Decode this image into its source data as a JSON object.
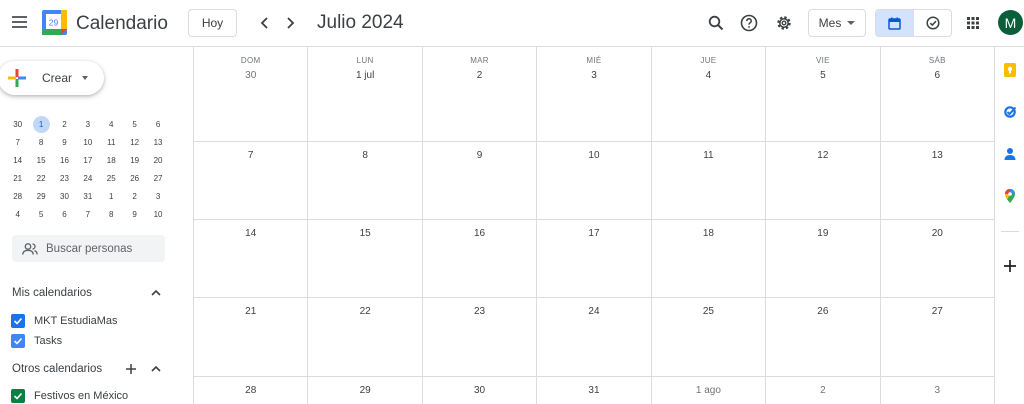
{
  "app": {
    "title": "Calendario",
    "logo_day": "29"
  },
  "toolbar": {
    "today_label": "Hoy",
    "month_title": "Julio 2024",
    "view_label": "Mes",
    "avatar_letter": "M"
  },
  "sidebar": {
    "create_label": "Crear",
    "mini_calendar": [
      [
        "30",
        "1",
        "2",
        "3",
        "4",
        "5",
        "6"
      ],
      [
        "7",
        "8",
        "9",
        "10",
        "11",
        "12",
        "13"
      ],
      [
        "14",
        "15",
        "16",
        "17",
        "18",
        "19",
        "20"
      ],
      [
        "21",
        "22",
        "23",
        "24",
        "25",
        "26",
        "27"
      ],
      [
        "28",
        "29",
        "30",
        "31",
        "1",
        "2",
        "3"
      ],
      [
        "4",
        "5",
        "6",
        "7",
        "8",
        "9",
        "10"
      ]
    ],
    "search_people_placeholder": "Buscar personas",
    "my_calendars_title": "Mis calendarios",
    "my_calendars": [
      {
        "label": "MKT EstudiaMas",
        "color": "#1a73e8"
      },
      {
        "label": "Tasks",
        "color": "#4285f4"
      }
    ],
    "other_calendars_title": "Otros calendarios",
    "other_calendars": [
      {
        "label": "Festivos en México",
        "color": "#0b8043"
      }
    ]
  },
  "grid": {
    "day_names": [
      "DOM",
      "LUN",
      "MAR",
      "MIÉ",
      "JUE",
      "VIE",
      "SÁB"
    ],
    "weeks": [
      [
        "30",
        "1 jul",
        "2",
        "3",
        "4",
        "5",
        "6"
      ],
      [
        "7",
        "8",
        "9",
        "10",
        "11",
        "12",
        "13"
      ],
      [
        "14",
        "15",
        "16",
        "17",
        "18",
        "19",
        "20"
      ],
      [
        "21",
        "22",
        "23",
        "24",
        "25",
        "26",
        "27"
      ],
      [
        "28",
        "29",
        "30",
        "31",
        "1 ago",
        "2",
        "3"
      ]
    ]
  },
  "colors": {
    "accent": "#1a73e8",
    "today_highlight": "#c2d7f8",
    "active_view": "#d3e3fd",
    "avatar_bg": "#0b5e3a"
  }
}
